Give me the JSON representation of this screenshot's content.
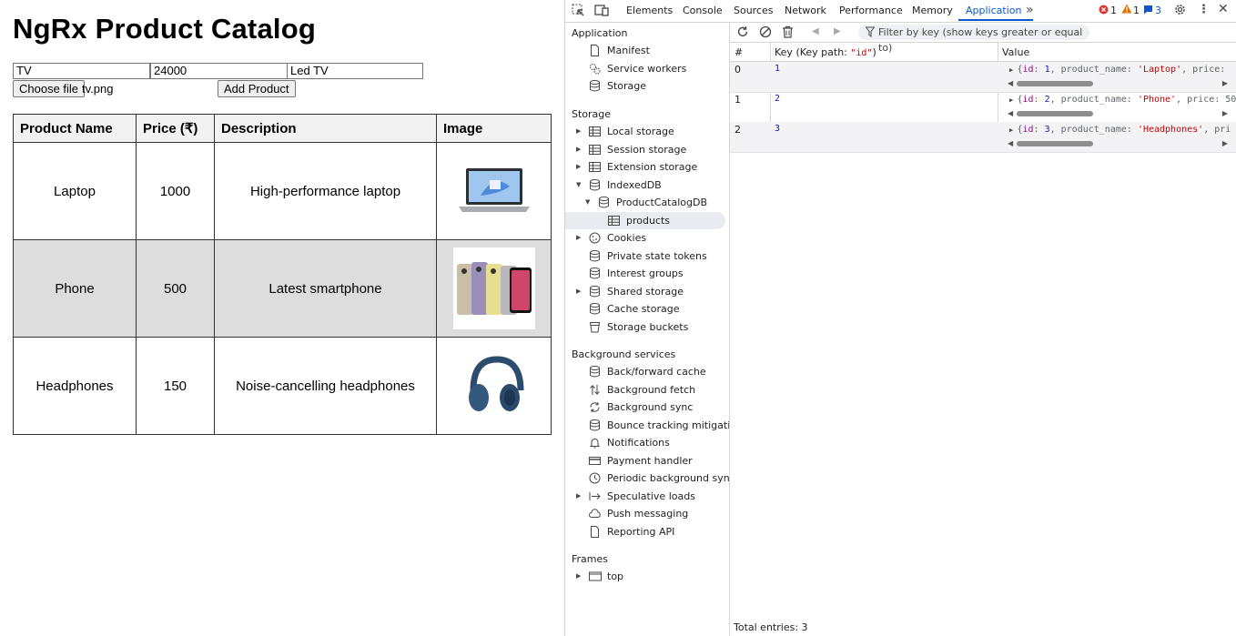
{
  "app": {
    "title": "NgRx Product Catalog",
    "form": {
      "name_value": "TV",
      "price_value": "24000",
      "description_value": "Led TV",
      "choose_file_label": "Choose file",
      "file_name": "tv.png",
      "add_button_label": "Add Product"
    },
    "table": {
      "headers": [
        "Product Name",
        "Price (₹)",
        "Description",
        "Image"
      ],
      "rows": [
        {
          "name": "Laptop",
          "price": "1000",
          "description": "High-performance laptop"
        },
        {
          "name": "Phone",
          "price": "500",
          "description": "Latest smartphone"
        },
        {
          "name": "Headphones",
          "price": "150",
          "description": "Noise-cancelling headphones"
        }
      ]
    }
  },
  "devtools": {
    "tabs": [
      "Elements",
      "Console",
      "Sources",
      "Network",
      "Performance",
      "Memory",
      "Application"
    ],
    "active_tab": "Application",
    "badges": {
      "errors": "1",
      "warnings": "1",
      "messages": "3"
    },
    "sidebar": {
      "section_application": "Application",
      "application_items": [
        "Manifest",
        "Service workers",
        "Storage"
      ],
      "section_storage": "Storage",
      "storage_items": [
        "Local storage",
        "Session storage",
        "Extension storage",
        "IndexedDB",
        "ProductCatalogDB",
        "products",
        "Cookies",
        "Private state tokens",
        "Interest groups",
        "Shared storage",
        "Cache storage",
        "Storage buckets"
      ],
      "section_background": "Background services",
      "background_items": [
        "Back/forward cache",
        "Background fetch",
        "Background sync",
        "Bounce tracking mitigati...",
        "Notifications",
        "Payment handler",
        "Periodic background sync",
        "Speculative loads",
        "Push messaging",
        "Reporting API"
      ],
      "section_frames": "Frames",
      "frames_items": [
        "top"
      ]
    },
    "filter_placeholder": "Filter by key (show keys greater or equal to)",
    "grid": {
      "col_index": "#",
      "col_key_prefix": "Key (Key path: ",
      "col_key_path": "\"id\"",
      "col_key_suffix": ")",
      "col_value": "Value",
      "rows": [
        {
          "index": "0",
          "key": "1",
          "id": "1",
          "product_name": "'Laptop'",
          "tail": "price: "
        },
        {
          "index": "1",
          "key": "2",
          "id": "2",
          "product_name": "'Phone'",
          "tail": "price: 50"
        },
        {
          "index": "2",
          "key": "3",
          "id": "3",
          "product_name": "'Headphones'",
          "tail": "pri"
        }
      ]
    },
    "footer": "Total entries: 3"
  },
  "colors": {
    "accent": "#0b57d0",
    "error": "#dc362e",
    "warning": "#e37400"
  }
}
